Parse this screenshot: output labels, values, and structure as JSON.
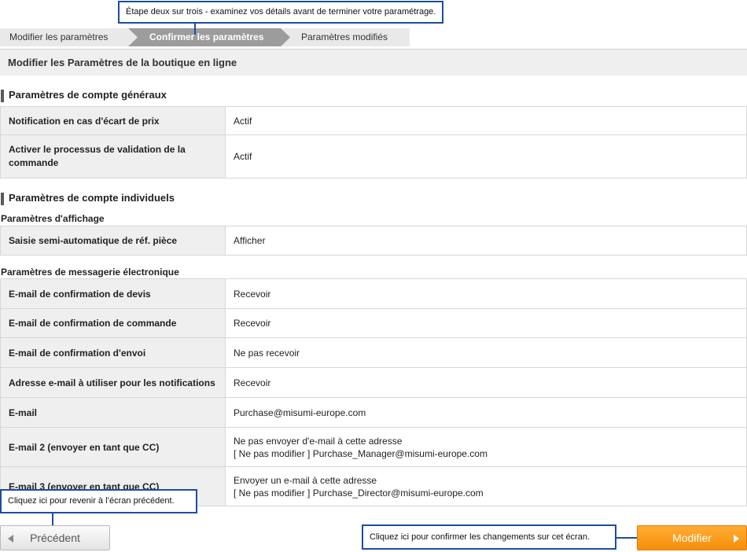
{
  "steps": {
    "step1": "Modifier les paramètres",
    "step2": "Confirmer les paramètres",
    "step3": "Paramètres modifiés"
  },
  "page_title": "Modifier les Paramètres de la boutique en ligne",
  "general": {
    "title": "Paramètres de compte généraux",
    "rows": [
      {
        "label": "Notification en cas d'écart de prix",
        "value": "Actif"
      },
      {
        "label": "Activer le processus de validation de la commande",
        "value": "Actif"
      }
    ]
  },
  "individual": {
    "title": "Paramètres de compte individuels",
    "display": {
      "title": "Paramètres d'affichage",
      "rows": [
        {
          "label": "Saisie semi-automatique de réf. pièce",
          "value": "Afficher"
        }
      ]
    },
    "email": {
      "title": "Paramètres de messagerie électronique",
      "rows": [
        {
          "label": "E-mail de confirmation de devis",
          "value": "Recevoir"
        },
        {
          "label": "E-mail de confirmation de commande",
          "value": "Recevoir"
        },
        {
          "label": "E-mail de confirmation d'envoi",
          "value": "Ne pas recevoir"
        },
        {
          "label": "Adresse e-mail à utiliser pour les notifications",
          "value": "Recevoir"
        },
        {
          "label": "E-mail",
          "value": "Purchase@misumi-europe.com"
        },
        {
          "label": "E-mail 2 (envoyer en tant que CC)",
          "value_line1": "Ne pas envoyer d'e-mail à cette adresse",
          "value_line2": "[ Ne pas modifier ]   Purchase_Manager@misumi-europe.com"
        },
        {
          "label": "E-mail 3 (envoyer en tant que CC)",
          "value_line1": "Envoyer un e-mail à cette adresse",
          "value_line2": "[ Ne pas modifier ]   Purchase_Director@misumi-europe.com"
        }
      ]
    }
  },
  "callouts": {
    "top": "Étape deux sur trois - examinez vos détails avant de terminer votre paramétrage.",
    "prev": "Cliquez ici pour revenir à l’écran précédent.",
    "next": "Cliquez ici pour confirmer les changements sur cet écran."
  },
  "buttons": {
    "prev": "Précédent",
    "next": "Modifier"
  },
  "colors": {
    "callout_border": "#1b4e9e",
    "primary_button": "#f68e0a",
    "active_step": "#9c9c9c"
  }
}
